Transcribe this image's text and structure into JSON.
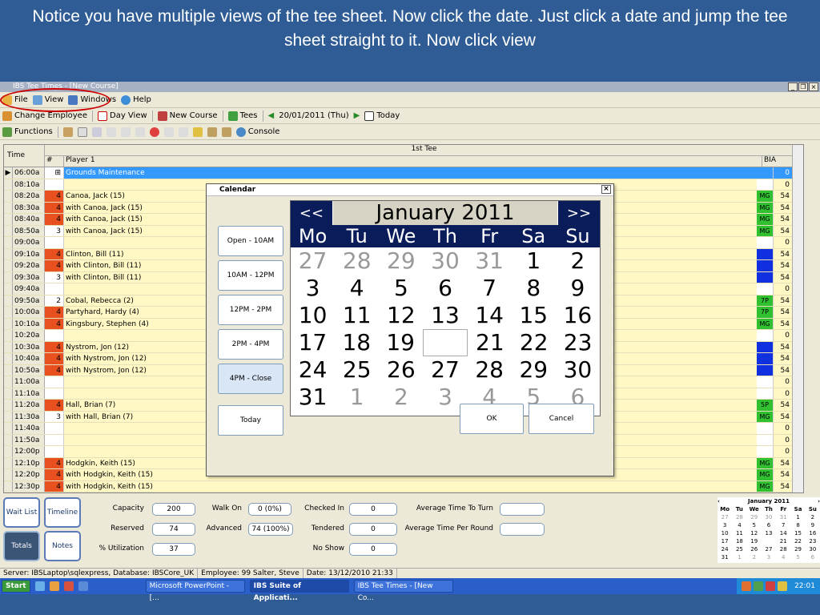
{
  "caption": "Notice you have multiple views of the tee sheet. Now click the date. Just click a date and jump the tee sheet straight to it.  Now click view",
  "window_title": "IBS Tee Times - [New Course]",
  "menu": [
    "File",
    "View",
    "Windows",
    "Help"
  ],
  "toolbar": {
    "change_employee": "Change Employee",
    "day_view": "Day View",
    "new_course": "New Course",
    "tees": "Tees",
    "date": "20/01/2011 (Thu)",
    "today": "Today"
  },
  "toolbar2": {
    "functions": "Functions",
    "console": "Console"
  },
  "grid": {
    "tee_title": "1st Tee",
    "col_time": "Time",
    "col_num": "#",
    "col_player": "Player 1",
    "col_bia": "BIA"
  },
  "rows": [
    {
      "time": "06:00a",
      "num": "",
      "player": "Grounds Maintenance",
      "tag": "",
      "bia": "0",
      "sel": true,
      "flag": false,
      "plus": true
    },
    {
      "time": "08:10a",
      "num": "",
      "player": "",
      "tag": "",
      "bia": "0"
    },
    {
      "time": "08:20a",
      "num": "4",
      "player": "Canoa, Jack (15)",
      "tag": "MG",
      "bia": "54",
      "flag": true
    },
    {
      "time": "08:30a",
      "num": "4",
      "player": "with Canoa, Jack (15)",
      "tag": "MG",
      "bia": "54",
      "flag": true
    },
    {
      "time": "08:40a",
      "num": "4",
      "player": "with Canoa, Jack (15)",
      "tag": "MG",
      "bia": "54",
      "flag": true
    },
    {
      "time": "08:50a",
      "num": "3",
      "player": "with Canoa, Jack (15)",
      "tag": "MG",
      "bia": "54"
    },
    {
      "time": "09:00a",
      "num": "",
      "player": "",
      "tag": "",
      "bia": "0"
    },
    {
      "time": "09:10a",
      "num": "4",
      "player": "Clinton, Bill (11)",
      "tag": "blue",
      "bia": "54",
      "flag": true
    },
    {
      "time": "09:20a",
      "num": "4",
      "player": "with Clinton, Bill (11)",
      "tag": "blue",
      "bia": "54",
      "flag": true
    },
    {
      "time": "09:30a",
      "num": "3",
      "player": "with Clinton, Bill (11)",
      "tag": "blue",
      "bia": "54"
    },
    {
      "time": "09:40a",
      "num": "",
      "player": "",
      "tag": "",
      "bia": "0"
    },
    {
      "time": "09:50a",
      "num": "2",
      "player": "Cobal, Rebecca (2)",
      "tag": "7P",
      "bia": "54"
    },
    {
      "time": "10:00a",
      "num": "4",
      "player": "Partyhard, Hardy (4)",
      "tag": "7P",
      "bia": "54",
      "flag": true
    },
    {
      "time": "10:10a",
      "num": "4",
      "player": "Kingsbury, Stephen (4)",
      "tag": "MG",
      "bia": "54",
      "flag": true
    },
    {
      "time": "10:20a",
      "num": "",
      "player": "",
      "tag": "",
      "bia": "0"
    },
    {
      "time": "10:30a",
      "num": "4",
      "player": "Nystrom, Jon (12)",
      "tag": "blue",
      "bia": "54",
      "flag": true
    },
    {
      "time": "10:40a",
      "num": "4",
      "player": "with Nystrom, Jon (12)",
      "tag": "blue",
      "bia": "54",
      "flag": true
    },
    {
      "time": "10:50a",
      "num": "4",
      "player": "with Nystrom, Jon (12)",
      "tag": "blue",
      "bia": "54",
      "flag": true
    },
    {
      "time": "11:00a",
      "num": "",
      "player": "",
      "tag": "",
      "bia": "0"
    },
    {
      "time": "11:10a",
      "num": "",
      "player": "",
      "tag": "",
      "bia": "0"
    },
    {
      "time": "11:20a",
      "num": "4",
      "player": "Hall, Brian (7)",
      "tag": "5P",
      "bia": "54",
      "flag": true
    },
    {
      "time": "11:30a",
      "num": "3",
      "player": "with Hall, Brian (7)",
      "tag": "MG",
      "bia": "54"
    },
    {
      "time": "11:40a",
      "num": "",
      "player": "",
      "tag": "",
      "bia": "0"
    },
    {
      "time": "11:50a",
      "num": "",
      "player": "",
      "tag": "",
      "bia": "0"
    },
    {
      "time": "12:00p",
      "num": "",
      "player": "",
      "tag": "",
      "bia": "0"
    },
    {
      "time": "12:10p",
      "num": "4",
      "player": "Hodgkin, Keith (15)",
      "tag": "MG",
      "bia": "54",
      "flag": true
    },
    {
      "time": "12:20p",
      "num": "4",
      "player": "with Hodgkin, Keith (15)",
      "tag": "MG",
      "bia": "54",
      "flag": true
    },
    {
      "time": "12:30p",
      "num": "4",
      "player": "with Hodgkin, Keith (15)",
      "tag": "MG",
      "bia": "54",
      "flag": true
    }
  ],
  "calendar": {
    "title": "Calendar",
    "prev": "<<",
    "next": ">>",
    "month": "January 2011",
    "dows": [
      "Mo",
      "Tu",
      "We",
      "Th",
      "Fr",
      "Sa",
      "Su"
    ],
    "weeks": [
      [
        "27",
        "28",
        "29",
        "30",
        "31",
        "1",
        "2"
      ],
      [
        "3",
        "4",
        "5",
        "6",
        "7",
        "8",
        "9"
      ],
      [
        "10",
        "11",
        "12",
        "13",
        "14",
        "15",
        "16"
      ],
      [
        "17",
        "18",
        "19",
        "",
        "21",
        "22",
        "23"
      ],
      [
        "24",
        "25",
        "26",
        "27",
        "28",
        "29",
        "30"
      ],
      [
        "31",
        "1",
        "2",
        "3",
        "4",
        "5",
        "6"
      ]
    ],
    "time_buttons": [
      "Open - 10AM",
      "10AM - 12PM",
      "12PM - 2PM",
      "2PM - 4PM",
      "4PM - Close"
    ],
    "today": "Today",
    "ok": "OK",
    "cancel": "Cancel"
  },
  "side_buttons": [
    "Wait List",
    "Timeline",
    "Totals",
    "Notes"
  ],
  "stats": [
    {
      "label": "Capacity",
      "value": "200"
    },
    {
      "label": "Walk On",
      "value": "0 (0%)"
    },
    {
      "label": "Checked In",
      "value": "0"
    },
    {
      "label": "Average Time To Turn",
      "value": ""
    },
    {
      "label": "Reserved",
      "value": "74"
    },
    {
      "label": "Advanced",
      "value": "74 (100%)"
    },
    {
      "label": "Tendered",
      "value": "0"
    },
    {
      "label": "Average Time Per Round",
      "value": ""
    },
    {
      "label": "% Utilization",
      "value": "37"
    },
    {
      "label": "No Show",
      "value": "0"
    }
  ],
  "mini_cal": {
    "month": "January 2011",
    "dows": [
      "Mo",
      "Tu",
      "We",
      "Th",
      "Fr",
      "Sa",
      "Su"
    ],
    "weeks": [
      [
        "27",
        "28",
        "29",
        "30",
        "31",
        "1",
        "2"
      ],
      [
        "3",
        "4",
        "5",
        "6",
        "7",
        "8",
        "9"
      ],
      [
        "10",
        "11",
        "12",
        "13",
        "14",
        "15",
        "16"
      ],
      [
        "17",
        "18",
        "19",
        "",
        "21",
        "22",
        "23"
      ],
      [
        "24",
        "25",
        "26",
        "27",
        "28",
        "29",
        "30"
      ],
      [
        "31",
        "1",
        "2",
        "3",
        "4",
        "5",
        "6"
      ]
    ]
  },
  "status": [
    "Server: IBSLaptop\\sqlexpress, Database: IBSCore_UK",
    "Employee: 99 Salter, Steve",
    "Date: 13/12/2010 21:33"
  ],
  "taskbar": {
    "start": "Start",
    "tasks": [
      "Microsoft PowerPoint - [...",
      "IBS Suite of Applicati...",
      "IBS Tee Times - [New Co..."
    ],
    "clock": "22:01"
  }
}
